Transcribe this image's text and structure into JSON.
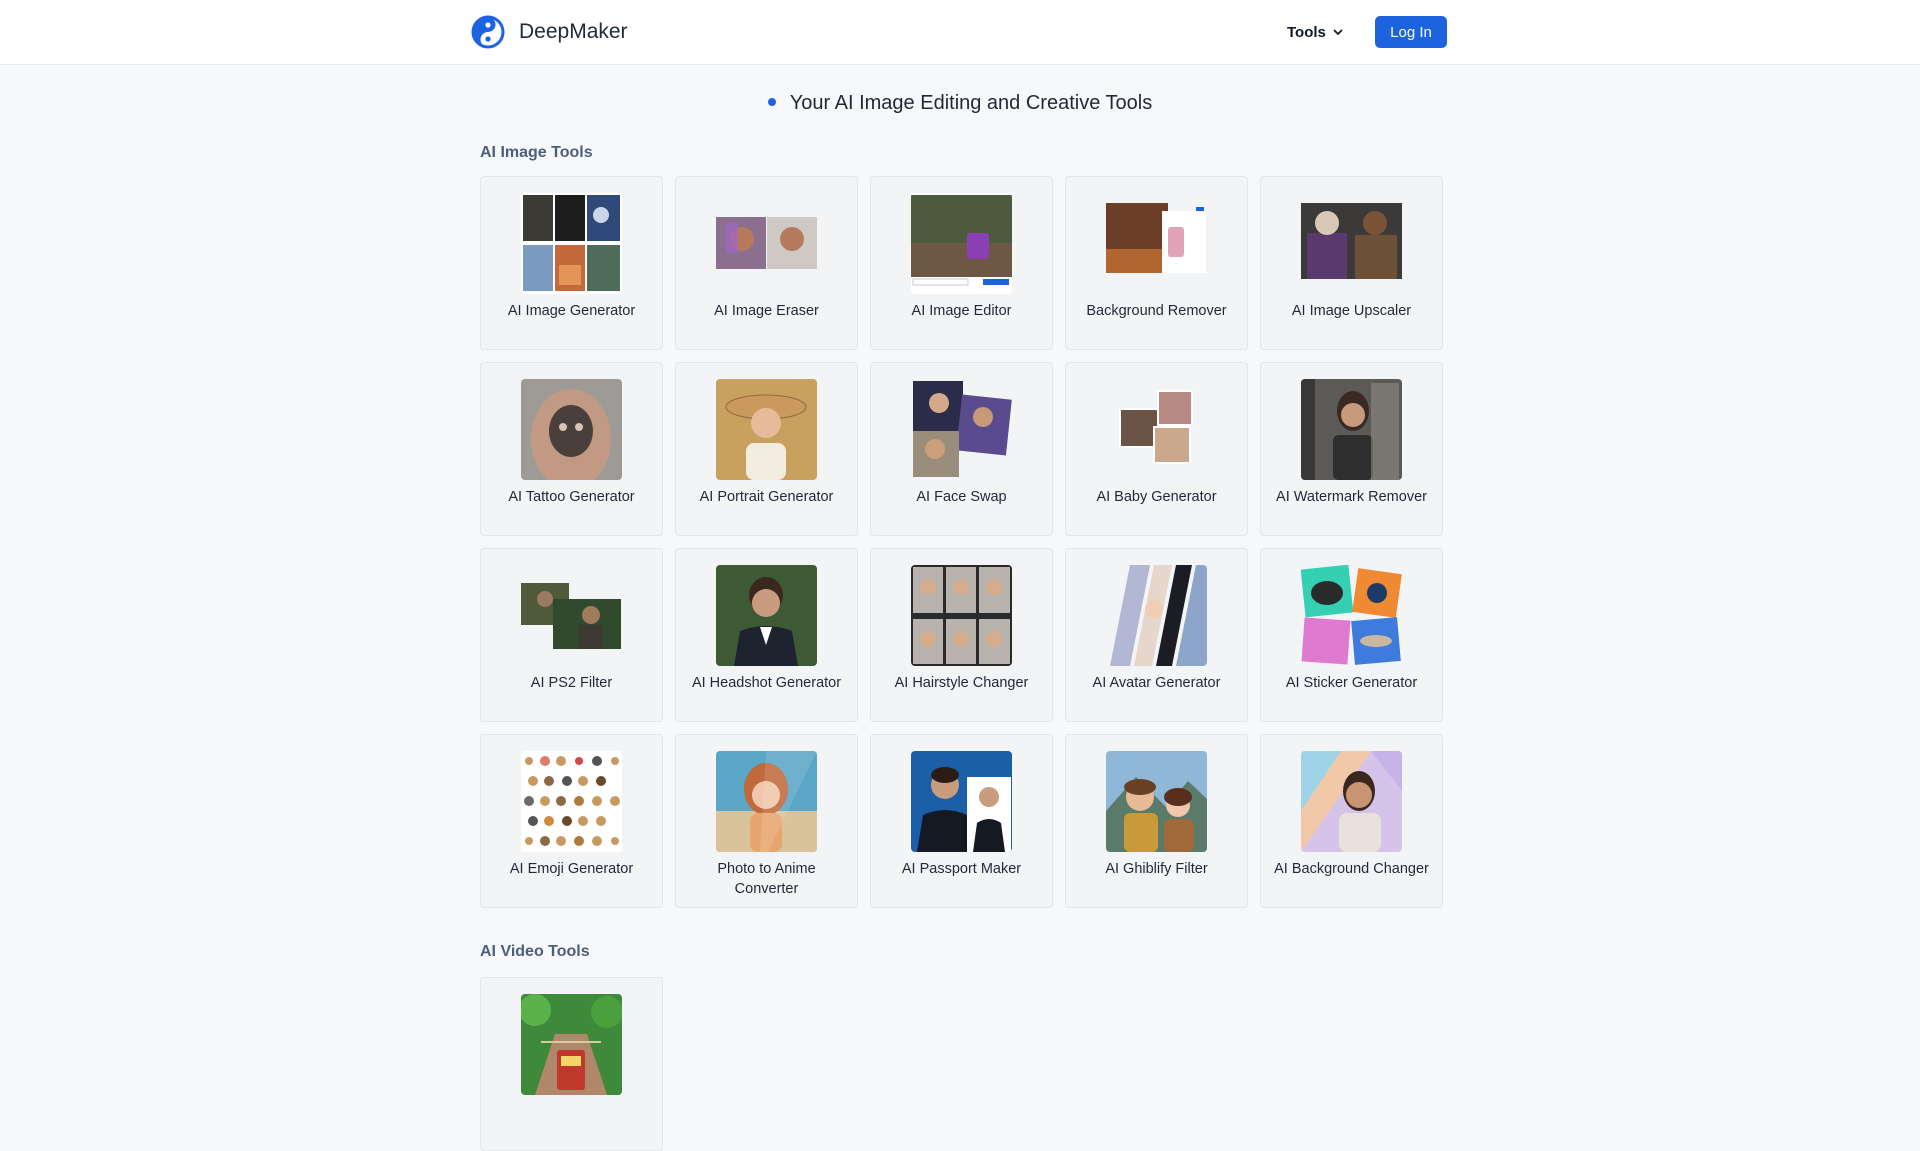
{
  "header": {
    "brand": "DeepMaker",
    "tools_label": "Tools",
    "login_label": "Log In",
    "accent_color": "#1d63e0"
  },
  "hero": {
    "tagline": "Your AI Image Editing and Creative Tools"
  },
  "sections": [
    {
      "title": "AI Image Tools",
      "tools": [
        {
          "label": "AI Image Generator"
        },
        {
          "label": "AI Image Eraser"
        },
        {
          "label": "AI Image Editor"
        },
        {
          "label": "Background Remover"
        },
        {
          "label": "AI Image Upscaler"
        },
        {
          "label": "AI Tattoo Generator"
        },
        {
          "label": "AI Portrait Generator"
        },
        {
          "label": "AI Face Swap"
        },
        {
          "label": "AI Baby Generator"
        },
        {
          "label": "AI Watermark Remover"
        },
        {
          "label": "AI PS2 Filter"
        },
        {
          "label": "AI Headshot Generator"
        },
        {
          "label": "AI Hairstyle Changer"
        },
        {
          "label": "AI Avatar Generator"
        },
        {
          "label": "AI Sticker Generator"
        },
        {
          "label": "AI Emoji Generator"
        },
        {
          "label": "Photo to Anime Converter"
        },
        {
          "label": "AI Passport Maker"
        },
        {
          "label": "AI Ghiblify Filter"
        },
        {
          "label": "AI Background Changer"
        }
      ]
    },
    {
      "title": "AI Video Tools",
      "tools": [
        {
          "label": ""
        }
      ]
    }
  ]
}
